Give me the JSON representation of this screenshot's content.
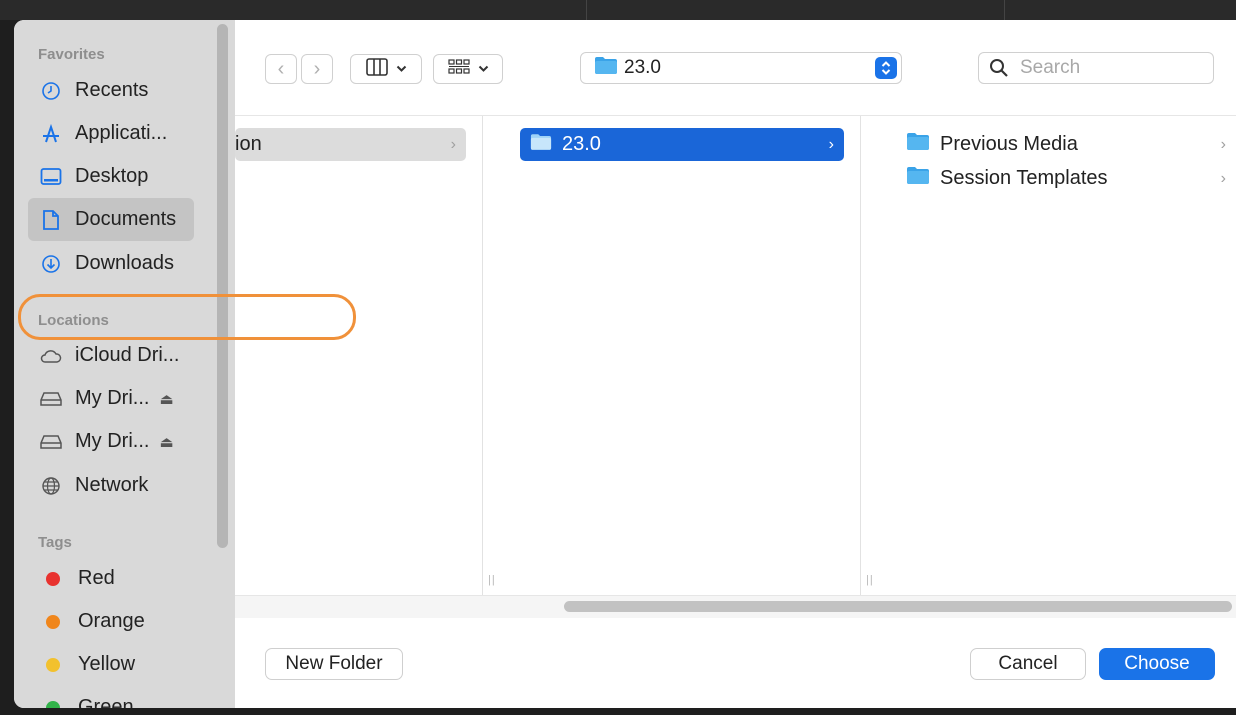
{
  "sidebar": {
    "favorites_title": "Favorites",
    "favorites": [
      {
        "label": "Recents",
        "icon": "clock-icon"
      },
      {
        "label": "Applicati...",
        "icon": "applications-icon"
      },
      {
        "label": "Desktop",
        "icon": "desktop-icon"
      },
      {
        "label": "Documents",
        "icon": "document-icon",
        "selected": true
      },
      {
        "label": "Downloads",
        "icon": "download-icon"
      }
    ],
    "locations_title": "Locations",
    "locations": [
      {
        "label": "iCloud Dri...",
        "icon": "cloud-icon"
      },
      {
        "label": "My Dri...",
        "icon": "drive-icon",
        "eject": "⏏"
      },
      {
        "label": "My Dri...",
        "icon": "drive-icon",
        "eject": "⏏"
      },
      {
        "label": "Network",
        "icon": "globe-icon"
      }
    ],
    "tags_title": "Tags",
    "tags": [
      {
        "label": "Red",
        "color": "#e8322f"
      },
      {
        "label": "Orange",
        "color": "#f0861c"
      },
      {
        "label": "Yellow",
        "color": "#f2c12e"
      },
      {
        "label": "Green",
        "color": "#32b34a"
      }
    ]
  },
  "toolbar": {
    "back": "‹",
    "forward": "›",
    "path_popup_label": "23.0",
    "search_placeholder": "Search"
  },
  "columns": {
    "col1_selected": "ion",
    "col2_selected": "23.0",
    "col3_items": [
      "Previous Media",
      "Session Templates"
    ]
  },
  "footer": {
    "new_folder": "New Folder",
    "cancel": "Cancel",
    "choose": "Choose"
  },
  "colors": {
    "accent": "#1a73e8",
    "highlight": "#f0913a"
  }
}
